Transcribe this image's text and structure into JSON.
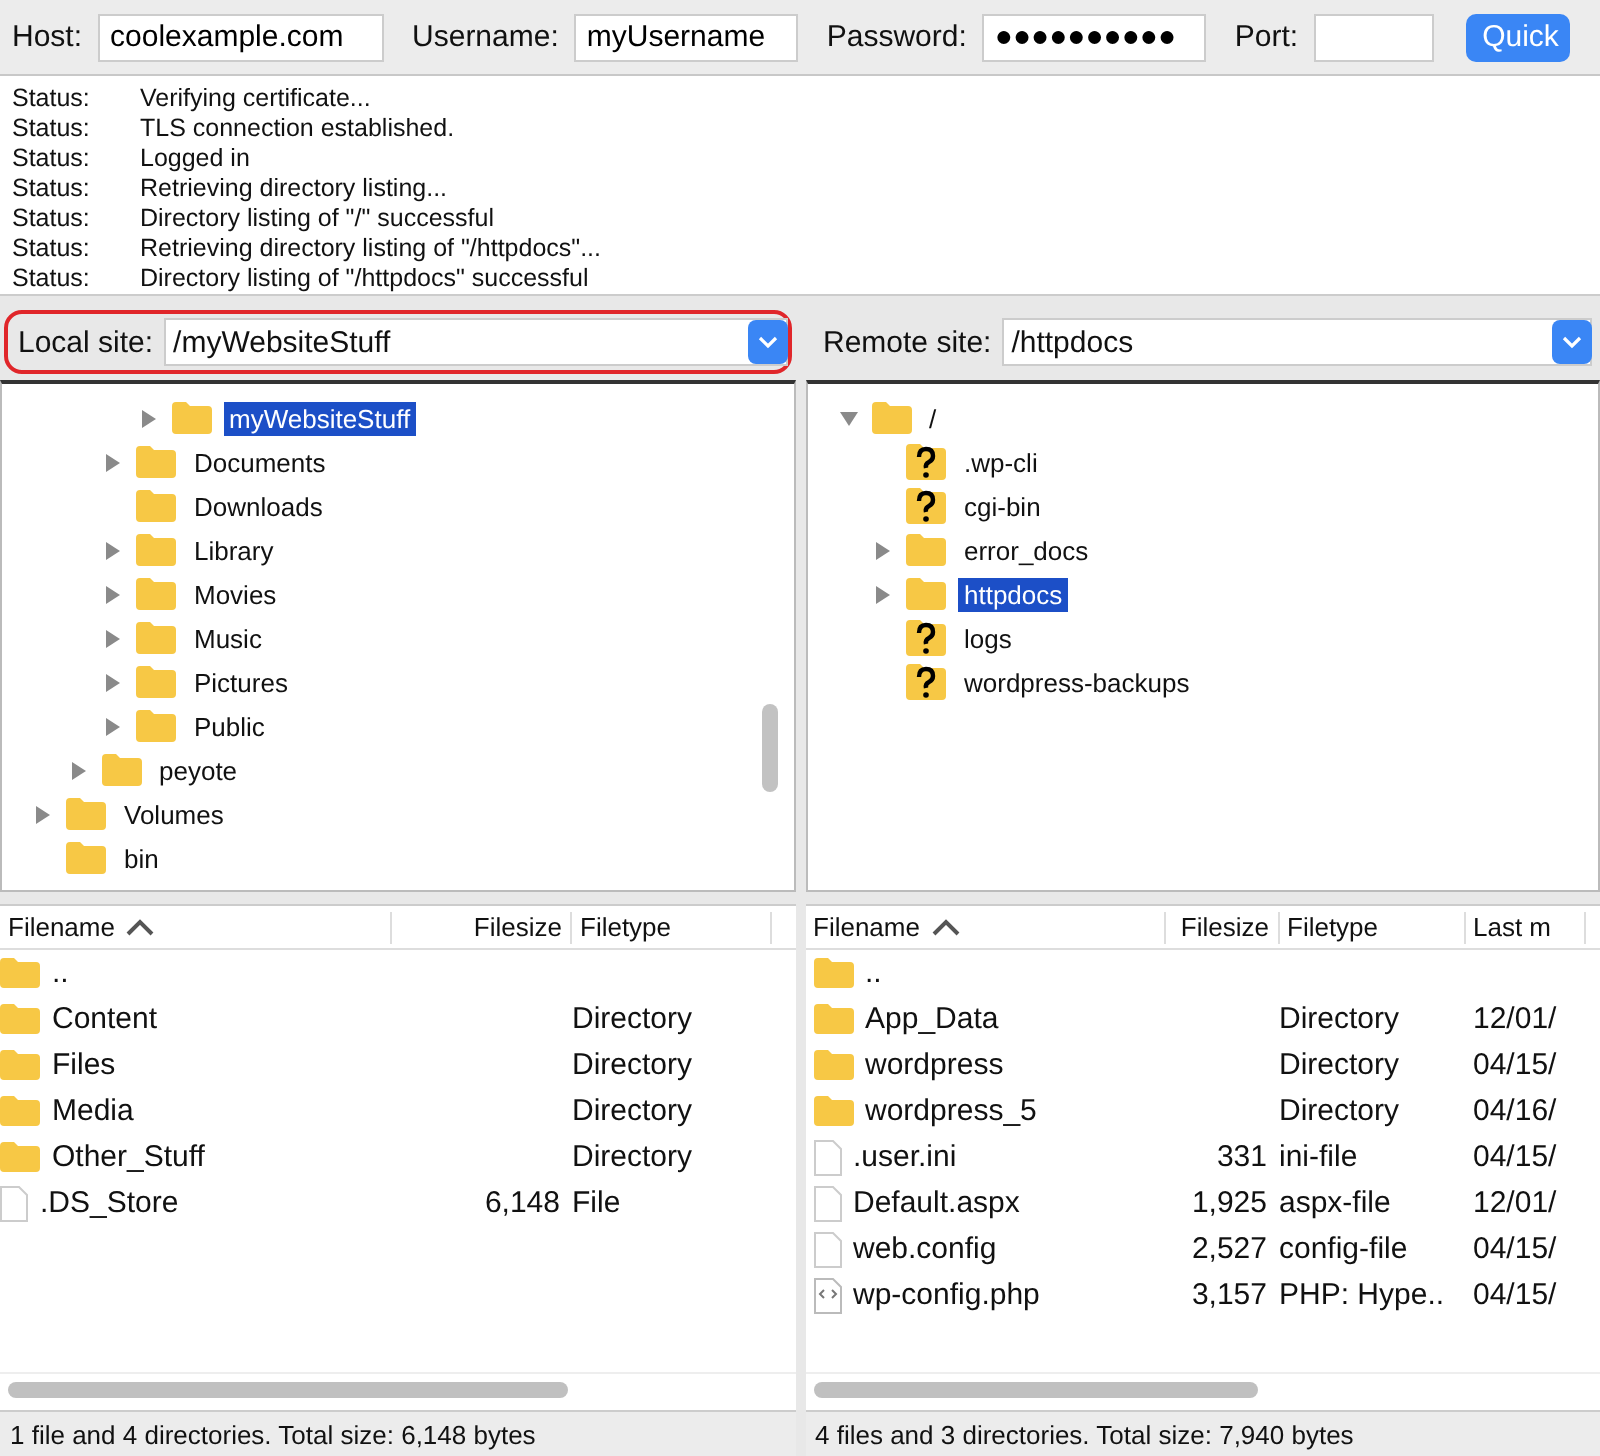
{
  "quickconnect": {
    "host_label": "Host:",
    "host": "coolexample.com",
    "username_label": "Username:",
    "username": "myUsername",
    "password_label": "Password:",
    "password": "●●●●●●●●●●",
    "port_label": "Port:",
    "button": "Quick"
  },
  "message_log": [
    {
      "label": "Status:",
      "text": "Verifying certificate..."
    },
    {
      "label": "Status:",
      "text": "TLS connection established."
    },
    {
      "label": "Status:",
      "text": "Logged in"
    },
    {
      "label": "Status:",
      "text": "Retrieving directory listing..."
    },
    {
      "label": "Status:",
      "text": "Directory listing of \"/\" successful"
    },
    {
      "label": "Status:",
      "text": "Retrieving directory listing of \"/httpdocs\"..."
    },
    {
      "label": "Status:",
      "text": "Directory listing of \"/httpdocs\" successful"
    }
  ],
  "panes": [
    {
      "site_label": "Local site:",
      "site_path": "/myWebsiteStuff",
      "highlighted": true,
      "tree": [
        {
          "children": [
            {
              "children": [
                {
                  "children": [
                    {
                      "name": "myWebsiteStuff",
                      "kind": "folder",
                      "expandable": true,
                      "expanded": false,
                      "selected": true
                    }
                  ]
                },
                {
                  "name": "Documents",
                  "kind": "folder",
                  "expandable": true,
                  "expanded": false,
                  "selected": false
                },
                {
                  "name": "Downloads",
                  "kind": "folder",
                  "expandable": false,
                  "expanded": false,
                  "selected": false
                },
                {
                  "name": "Library",
                  "kind": "folder",
                  "expandable": true,
                  "expanded": false,
                  "selected": false
                },
                {
                  "name": "Movies",
                  "kind": "folder",
                  "expandable": true,
                  "expanded": false,
                  "selected": false
                },
                {
                  "name": "Music",
                  "kind": "folder",
                  "expandable": true,
                  "expanded": false,
                  "selected": false
                },
                {
                  "name": "Pictures",
                  "kind": "folder",
                  "expandable": true,
                  "expanded": false,
                  "selected": false
                },
                {
                  "name": "Public",
                  "kind": "folder",
                  "expandable": true,
                  "expanded": false,
                  "selected": false
                }
              ]
            },
            {
              "name": "peyote",
              "kind": "folder",
              "expandable": true,
              "expanded": false,
              "selected": false
            }
          ]
        },
        {
          "name": "Volumes",
          "kind": "folder",
          "expandable": true,
          "expanded": false,
          "selected": false
        },
        {
          "name": "bin",
          "kind": "folder",
          "expandable": false,
          "expanded": false,
          "selected": false
        }
      ],
      "columns": [
        "Filename",
        "Filesize",
        "Filetype"
      ],
      "files": [
        {
          "kind": "folder",
          "cells": [
            "..",
            "",
            ""
          ]
        },
        {
          "kind": "folder",
          "cells": [
            "Content",
            "",
            "Directory"
          ]
        },
        {
          "kind": "folder",
          "cells": [
            "Files",
            "",
            "Directory"
          ]
        },
        {
          "kind": "folder",
          "cells": [
            "Media",
            "",
            "Directory"
          ]
        },
        {
          "kind": "folder",
          "cells": [
            "Other_Stuff",
            "",
            "Directory"
          ]
        },
        {
          "kind": "file",
          "cells": [
            ".DS_Store",
            "6,148",
            "File"
          ]
        }
      ],
      "status": "1 file and 4 directories. Total size: 6,148 bytes"
    },
    {
      "site_label": "Remote site:",
      "site_path": "/httpdocs",
      "highlighted": false,
      "tree": [
        {
          "name": "/",
          "kind": "folder",
          "expandable": true,
          "expanded": true,
          "selected": false,
          "children": [
            {
              "name": ".wp-cli",
              "kind": "unknown",
              "expandable": false,
              "expanded": false,
              "selected": false
            },
            {
              "name": "cgi-bin",
              "kind": "unknown",
              "expandable": false,
              "expanded": false,
              "selected": false
            },
            {
              "name": "error_docs",
              "kind": "folder",
              "expandable": true,
              "expanded": false,
              "selected": false
            },
            {
              "name": "httpdocs",
              "kind": "folder",
              "expandable": true,
              "expanded": false,
              "selected": true
            },
            {
              "name": "logs",
              "kind": "unknown",
              "expandable": false,
              "expanded": false,
              "selected": false
            },
            {
              "name": "wordpress-backups",
              "kind": "unknown",
              "expandable": false,
              "expanded": false,
              "selected": false
            }
          ]
        }
      ],
      "columns": [
        "Filename",
        "Filesize",
        "Filetype",
        "Last m"
      ],
      "files": [
        {
          "kind": "folder",
          "cells": [
            "..",
            "",
            "",
            ""
          ]
        },
        {
          "kind": "folder",
          "cells": [
            "App_Data",
            "",
            "Directory",
            "12/01/"
          ]
        },
        {
          "kind": "folder",
          "cells": [
            "wordpress",
            "",
            "Directory",
            "04/15/"
          ]
        },
        {
          "kind": "folder",
          "cells": [
            "wordpress_5",
            "",
            "Directory",
            "04/16/"
          ]
        },
        {
          "kind": "file",
          "cells": [
            ".user.ini",
            "331",
            "ini-file",
            "04/15/"
          ]
        },
        {
          "kind": "file",
          "cells": [
            "Default.aspx",
            "1,925",
            "aspx-file",
            "12/01/"
          ]
        },
        {
          "kind": "file",
          "cells": [
            "web.config",
            "2,527",
            "config-file",
            "04/15/"
          ]
        },
        {
          "kind": "code",
          "cells": [
            "wp-config.php",
            "3,157",
            "PHP: Hype..",
            "04/15/"
          ]
        }
      ],
      "status": "4 files and 3 directories. Total size: 7,940 bytes"
    }
  ]
}
